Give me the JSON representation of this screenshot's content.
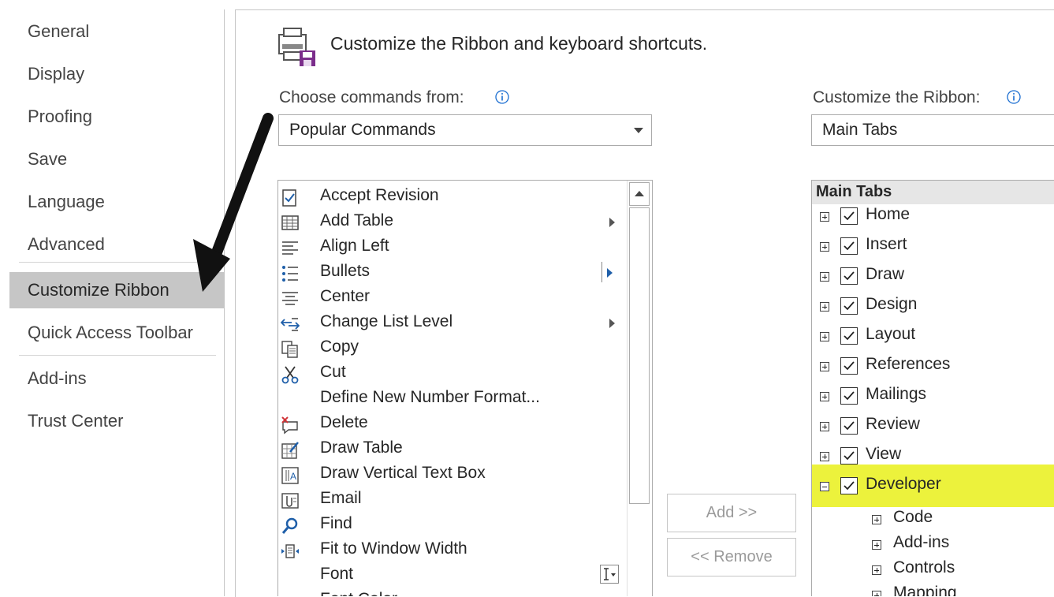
{
  "nav": {
    "items": [
      {
        "label": "General"
      },
      {
        "label": "Display"
      },
      {
        "label": "Proofing"
      },
      {
        "label": "Save"
      },
      {
        "label": "Language"
      },
      {
        "label": "Advanced"
      },
      {
        "label": "Customize Ribbon",
        "selected": true
      },
      {
        "label": "Quick Access Toolbar"
      },
      {
        "label": "Add-ins"
      },
      {
        "label": "Trust Center"
      }
    ]
  },
  "header": {
    "title": "Customize the Ribbon and keyboard shortcuts."
  },
  "commands": {
    "label": "Choose commands from:",
    "dropdown_value": "Popular Commands",
    "items": [
      {
        "label": "Accept Revision",
        "icon": "accept-revision-icon"
      },
      {
        "label": "Add Table",
        "icon": "table-icon",
        "submenu": true
      },
      {
        "label": "Align Left",
        "icon": "align-left-icon"
      },
      {
        "label": "Bullets",
        "icon": "bullets-icon",
        "split": true
      },
      {
        "label": "Center",
        "icon": "align-center-icon"
      },
      {
        "label": "Change List Level",
        "icon": "change-list-level-icon",
        "submenu": true
      },
      {
        "label": "Copy",
        "icon": "copy-icon"
      },
      {
        "label": "Cut",
        "icon": "scissors-icon"
      },
      {
        "label": "Define New Number Format...",
        "icon": ""
      },
      {
        "label": "Delete",
        "icon": "delete-comment-icon"
      },
      {
        "label": "Draw Table",
        "icon": "draw-table-icon"
      },
      {
        "label": "Draw Vertical Text Box",
        "icon": "vertical-text-box-icon"
      },
      {
        "label": "Email",
        "icon": "email-icon"
      },
      {
        "label": "Find",
        "icon": "find-icon"
      },
      {
        "label": "Fit to Window Width",
        "icon": "fit-width-icon"
      },
      {
        "label": "Font",
        "icon": "",
        "font_box": true
      },
      {
        "label": "Font Color",
        "icon": "font-color-icon",
        "submenu": true
      }
    ]
  },
  "buttons": {
    "add": "Add >>",
    "remove": "<< Remove"
  },
  "ribbon": {
    "label": "Customize the Ribbon:",
    "dropdown_value": "Main Tabs",
    "header": "Main Tabs",
    "tabs": [
      {
        "label": "Home",
        "checked": true,
        "expanded": false
      },
      {
        "label": "Insert",
        "checked": true,
        "expanded": false
      },
      {
        "label": "Draw",
        "checked": true,
        "expanded": false
      },
      {
        "label": "Design",
        "checked": true,
        "expanded": false
      },
      {
        "label": "Layout",
        "checked": true,
        "expanded": false
      },
      {
        "label": "References",
        "checked": true,
        "expanded": false
      },
      {
        "label": "Mailings",
        "checked": true,
        "expanded": false
      },
      {
        "label": "Review",
        "checked": true,
        "expanded": false
      },
      {
        "label": "View",
        "checked": true,
        "expanded": false
      },
      {
        "label": "Developer",
        "checked": true,
        "expanded": true,
        "highlighted": true
      }
    ],
    "groups": [
      {
        "label": "Code"
      },
      {
        "label": "Add-ins"
      },
      {
        "label": "Controls"
      },
      {
        "label": "Mapping"
      }
    ]
  },
  "colors": {
    "highlight": "#ecf23c",
    "selected_nav": "#c6c6c6",
    "accent": "#0a64ad"
  }
}
